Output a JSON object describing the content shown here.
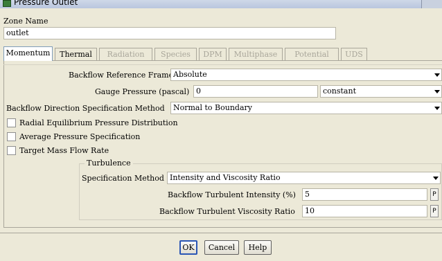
{
  "window": {
    "title": "Pressure Outlet"
  },
  "zone": {
    "label": "Zone Name",
    "value": "outlet"
  },
  "tabs": [
    {
      "label": "Momentum"
    },
    {
      "label": "Thermal"
    },
    {
      "label": "Radiation"
    },
    {
      "label": "Species"
    },
    {
      "label": "DPM"
    },
    {
      "label": "Multiphase"
    },
    {
      "label": "Potential"
    },
    {
      "label": "UDS"
    }
  ],
  "momentum": {
    "backflow_frame": {
      "label": "Backflow Reference Frame",
      "value": "Absolute"
    },
    "gauge_pressure": {
      "label": "Gauge Pressure (pascal)",
      "value": "0",
      "method": "constant"
    },
    "backflow_direction": {
      "label": "Backflow Direction Specification Method",
      "value": "Normal to Boundary"
    },
    "checkboxes": [
      {
        "label": "Radial Equilibrium Pressure Distribution",
        "checked": false
      },
      {
        "label": "Average Pressure Specification",
        "checked": false
      },
      {
        "label": "Target Mass Flow Rate",
        "checked": false
      }
    ],
    "turbulence": {
      "title": "Turbulence",
      "spec_method": {
        "label": "Specification Method",
        "value": "Intensity and Viscosity Ratio"
      },
      "intensity": {
        "label": "Backflow Turbulent Intensity (%)",
        "value": "5",
        "param": "P"
      },
      "viscosity": {
        "label": "Backflow Turbulent Viscosity Ratio",
        "value": "10",
        "param": "P"
      }
    }
  },
  "buttons": {
    "ok": "OK",
    "cancel": "Cancel",
    "help": "Help"
  }
}
